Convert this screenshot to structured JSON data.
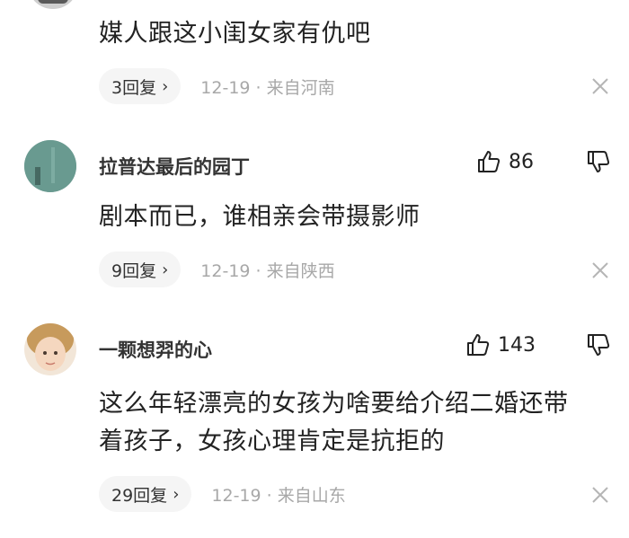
{
  "comments": [
    {
      "text": "媒人跟这小闺女家有仇吧",
      "reply_label": "3回复",
      "date_loc": "12-19 · 来自河南"
    },
    {
      "username": "拉普达最后的园丁",
      "likes": "86",
      "text": "剧本而已，谁相亲会带摄影师",
      "reply_label": "9回复",
      "date_loc": "12-19 · 来自陕西"
    },
    {
      "username": "一颗想羿的心",
      "likes": "143",
      "text_line1": "这么年轻漂亮的女孩为啥要给介绍二婚还带",
      "text_line2": "着孩子，女孩心理肯定是抗拒的",
      "reply_label": "29回复",
      "date_loc": "12-19 · 来自山东"
    }
  ],
  "icons": {
    "like": "thumbs-up-icon",
    "dislike": "thumbs-down-icon",
    "close": "close-icon",
    "chevron": "chevron-right-icon"
  }
}
